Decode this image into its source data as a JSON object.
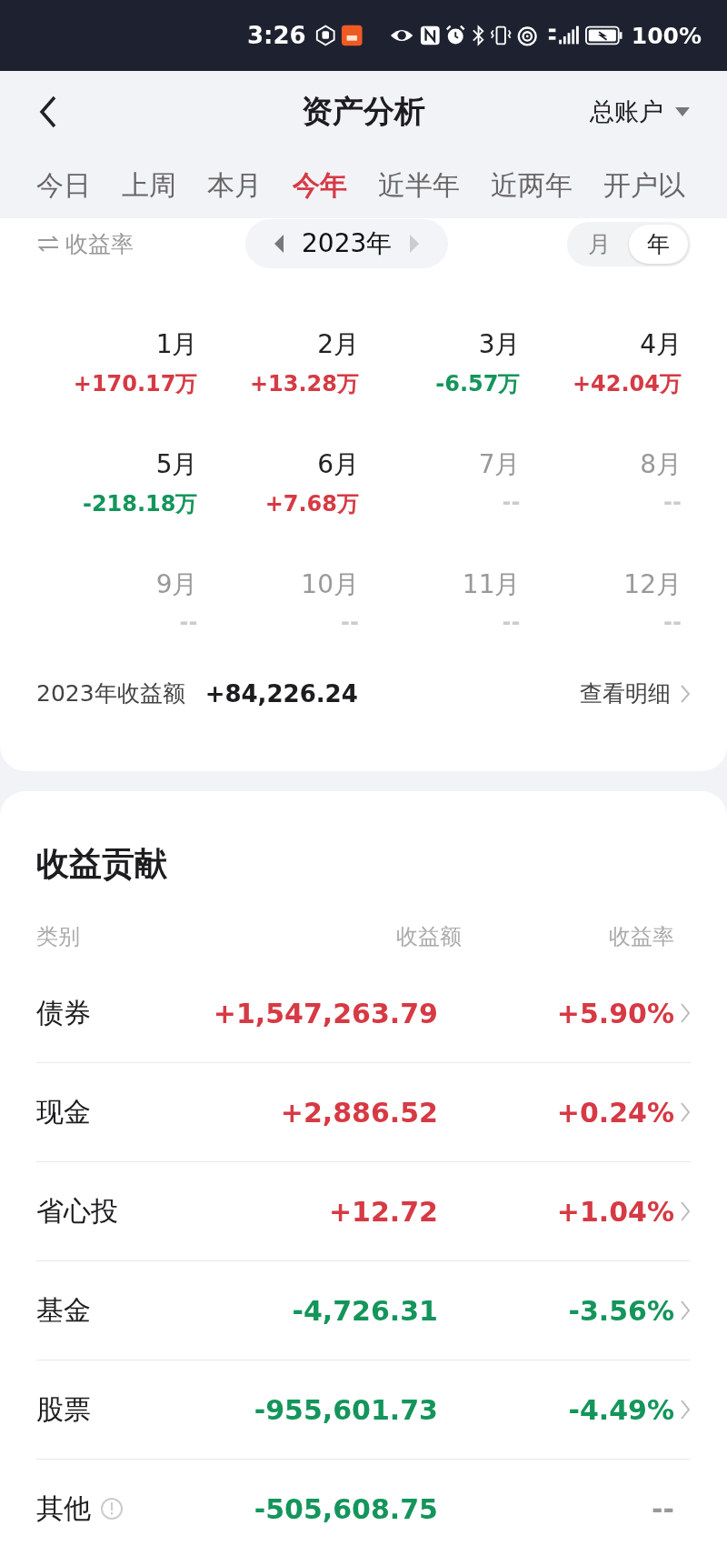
{
  "status_bar": {
    "time": "3:26",
    "battery": "100%"
  },
  "header": {
    "title": "资产分析",
    "account": "总账户"
  },
  "tabs": [
    {
      "label": "今日",
      "selected": false
    },
    {
      "label": "上周",
      "selected": false
    },
    {
      "label": "本月",
      "selected": false
    },
    {
      "label": "今年",
      "selected": true
    },
    {
      "label": "近半年",
      "selected": false
    },
    {
      "label": "近两年",
      "selected": false
    },
    {
      "label": "开户以",
      "selected": false
    }
  ],
  "summary": {
    "metric_switch": "收益率",
    "year": "2023年",
    "period_toggle": [
      {
        "label": "月",
        "selected": false
      },
      {
        "label": "年",
        "selected": true
      }
    ],
    "months": [
      {
        "label": "1月",
        "value": "+170.17万",
        "kind": "gain"
      },
      {
        "label": "2月",
        "value": "+13.28万",
        "kind": "gain"
      },
      {
        "label": "3月",
        "value": "-6.57万",
        "kind": "loss"
      },
      {
        "label": "4月",
        "value": "+42.04万",
        "kind": "gain"
      },
      {
        "label": "5月",
        "value": "-218.18万",
        "kind": "loss"
      },
      {
        "label": "6月",
        "value": "+7.68万",
        "kind": "gain"
      },
      {
        "label": "7月",
        "value": "--",
        "kind": "empty"
      },
      {
        "label": "8月",
        "value": "--",
        "kind": "empty"
      },
      {
        "label": "9月",
        "value": "--",
        "kind": "empty"
      },
      {
        "label": "10月",
        "value": "--",
        "kind": "empty"
      },
      {
        "label": "11月",
        "value": "--",
        "kind": "empty"
      },
      {
        "label": "12月",
        "value": "--",
        "kind": "empty"
      }
    ],
    "total_label": "2023年收益额",
    "total_value": "+84,226.24",
    "details_link": "查看明细"
  },
  "contribution": {
    "title": "收益贡献",
    "columns": [
      "类别",
      "收益额",
      "收益率"
    ],
    "rows": [
      {
        "category": "债券",
        "amount": "+1,547,263.79",
        "rate": "+5.90%",
        "kind": "gain",
        "info": false,
        "chevron": true
      },
      {
        "category": "现金",
        "amount": "+2,886.52",
        "rate": "+0.24%",
        "kind": "gain",
        "info": false,
        "chevron": true
      },
      {
        "category": "省心投",
        "amount": "+12.72",
        "rate": "+1.04%",
        "kind": "gain",
        "info": false,
        "chevron": true
      },
      {
        "category": "基金",
        "amount": "-4,726.31",
        "rate": "-3.56%",
        "kind": "loss",
        "info": false,
        "chevron": true
      },
      {
        "category": "股票",
        "amount": "-955,601.73",
        "rate": "-4.49%",
        "kind": "loss",
        "info": false,
        "chevron": true
      },
      {
        "category": "其他",
        "amount": "-505,608.75",
        "rate": "--",
        "kind": "unrated",
        "info": true,
        "chevron": false
      }
    ]
  }
}
